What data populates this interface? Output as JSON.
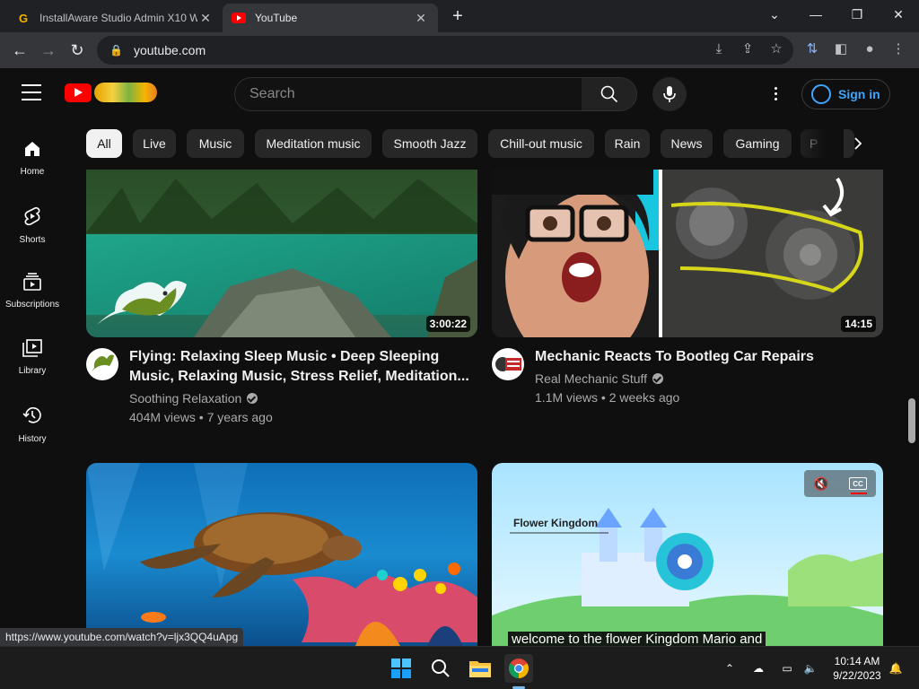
{
  "browser": {
    "tabs": [
      {
        "title": "InstallAware Studio Admin X10 W",
        "favicon": "G"
      },
      {
        "title": "YouTube",
        "favicon": "youtube-icon"
      }
    ],
    "url": "youtube.com",
    "status_url": "https://www.youtube.com/watch?v=ljx3QQ4uApg"
  },
  "masthead": {
    "search_placeholder": "Search",
    "signin_label": "Sign in"
  },
  "sidebar": {
    "items": [
      {
        "label": "Home",
        "icon": "home-icon"
      },
      {
        "label": "Shorts",
        "icon": "shorts-icon"
      },
      {
        "label": "Subscriptions",
        "icon": "subscriptions-icon"
      },
      {
        "label": "Library",
        "icon": "library-icon"
      },
      {
        "label": "History",
        "icon": "history-icon"
      }
    ]
  },
  "chips": [
    "All",
    "Live",
    "Music",
    "Meditation music",
    "Smooth Jazz",
    "Chill-out music",
    "Rain",
    "News",
    "Gaming",
    "P"
  ],
  "videos": [
    {
      "title_line1": "Flying: Relaxing Sleep Music • Deep Sleeping",
      "title_line2": "Music, Relaxing Music, Stress Relief, Meditation...",
      "channel": "Soothing Relaxation",
      "stats": "404M views • 7 years ago",
      "duration": "3:00:22"
    },
    {
      "title_line1": "Mechanic Reacts To Bootleg Car Repairs",
      "channel": "Real Mechanic Stuff",
      "stats": "1.1M views • 2 weeks ago",
      "duration": "14:15"
    },
    {
      "thumbnail": "underwater sea turtle over coral reef"
    },
    {
      "overlay_title": "Flower Kingdom",
      "caption": "welcome to the flower Kingdom Mario and",
      "cc_label": "CC"
    }
  ],
  "taskbar": {
    "time": "10:14 AM",
    "date": "9/22/2023"
  }
}
